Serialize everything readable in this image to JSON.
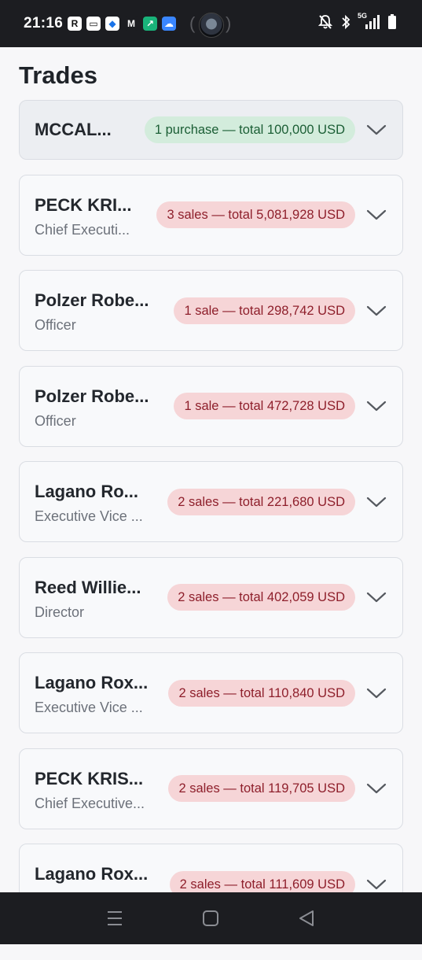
{
  "status_bar": {
    "time": "21:16",
    "apps": [
      {
        "name": "r-app-icon",
        "glyph": "R",
        "bg": "#ffffff",
        "fg": "#111111"
      },
      {
        "name": "wallet-app-icon",
        "glyph": "▭",
        "bg": "#ffffff",
        "fg": "#111111"
      },
      {
        "name": "box-app-icon",
        "glyph": "◆",
        "bg": "#ffffff",
        "fg": "#1a73e8"
      },
      {
        "name": "gmail-app-icon",
        "glyph": "M",
        "bg": "#1c1d21",
        "fg": "#ffffff"
      },
      {
        "name": "trend-app-icon",
        "glyph": "↗",
        "bg": "#19b37a",
        "fg": "#ffffff"
      },
      {
        "name": "weather-app-icon",
        "glyph": "☁",
        "bg": "#3a86ff",
        "fg": "#ffffff"
      }
    ],
    "network": "5G"
  },
  "page": {
    "title": "Trades"
  },
  "trades": [
    {
      "name": "MCCAL...",
      "role": "",
      "summary": "1 purchase — total 100,000 USD",
      "kind": "purchase"
    },
    {
      "name": "PECK KRI...",
      "role": "Chief Executi...",
      "summary": "3 sales — total 5,081,928 USD",
      "kind": "sale"
    },
    {
      "name": "Polzer Robe...",
      "role": "Officer",
      "summary": "1 sale — total 298,742 USD",
      "kind": "sale"
    },
    {
      "name": "Polzer Robe...",
      "role": "Officer",
      "summary": "1 sale — total 472,728 USD",
      "kind": "sale"
    },
    {
      "name": "Lagano Ro...",
      "role": "Executive Vice ...",
      "summary": "2 sales — total 221,680 USD",
      "kind": "sale"
    },
    {
      "name": "Reed Willie...",
      "role": "Director",
      "summary": "2 sales — total 402,059 USD",
      "kind": "sale"
    },
    {
      "name": "Lagano Rox...",
      "role": "Executive Vice ...",
      "summary": "2 sales — total 110,840 USD",
      "kind": "sale"
    },
    {
      "name": "PECK KRIS...",
      "role": "Chief Executive...",
      "summary": "2 sales — total 119,705 USD",
      "kind": "sale"
    },
    {
      "name": "Lagano Rox...",
      "role": "",
      "summary": "2 sales — total 111,609 USD",
      "kind": "sale"
    }
  ],
  "peek_badge": "2 sales — total 111,609 USD",
  "colors": {
    "sale_bg": "#f6d5d7",
    "sale_fg": "#8e1f2b",
    "purchase_bg": "#d3ecdc",
    "purchase_fg": "#1b5e35"
  }
}
